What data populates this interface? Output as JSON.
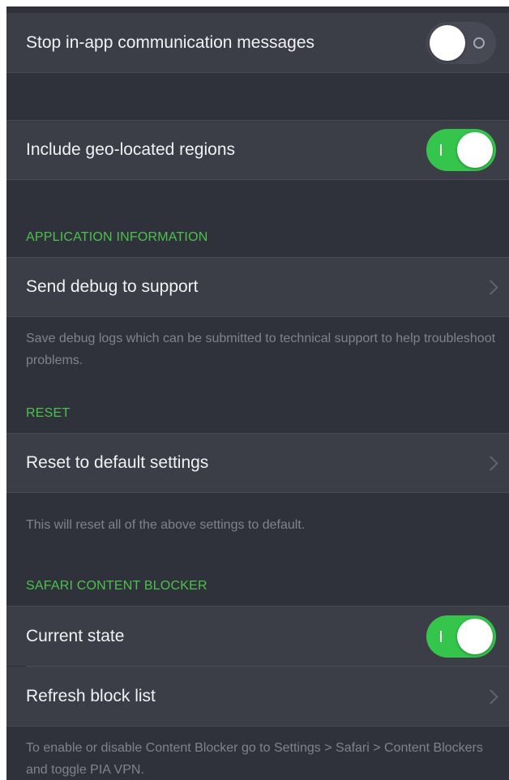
{
  "colors": {
    "background": "#30323b",
    "row_background": "#3b3d47",
    "section_header": "#4cc14c",
    "toggle_on": "#35c44c",
    "footer_text": "#80828c"
  },
  "rows": {
    "stop_messages": {
      "label": "Stop in-app communication messages",
      "toggle_state": "off"
    },
    "geo_regions": {
      "label": "Include geo-located regions",
      "toggle_state": "on"
    },
    "send_debug": {
      "label": "Send debug to support",
      "icon": "chevron-right-icon"
    },
    "reset_defaults": {
      "label": "Reset to default settings",
      "icon": "chevron-right-icon"
    },
    "current_state": {
      "label": "Current state",
      "toggle_state": "on"
    },
    "refresh_block_list": {
      "label": "Refresh block list",
      "icon": "chevron-right-icon"
    }
  },
  "sections": {
    "app_info": {
      "header": "APPLICATION INFORMATION",
      "footer": "Save debug logs which can be submitted to technical support to help troubleshoot problems."
    },
    "reset": {
      "header": "RESET",
      "footer": "This will reset all of the above settings to default."
    },
    "safari": {
      "header": "SAFARI CONTENT BLOCKER",
      "footer": "To enable or disable Content Blocker go to Settings > Safari > Content Blockers and toggle PIA VPN."
    }
  }
}
